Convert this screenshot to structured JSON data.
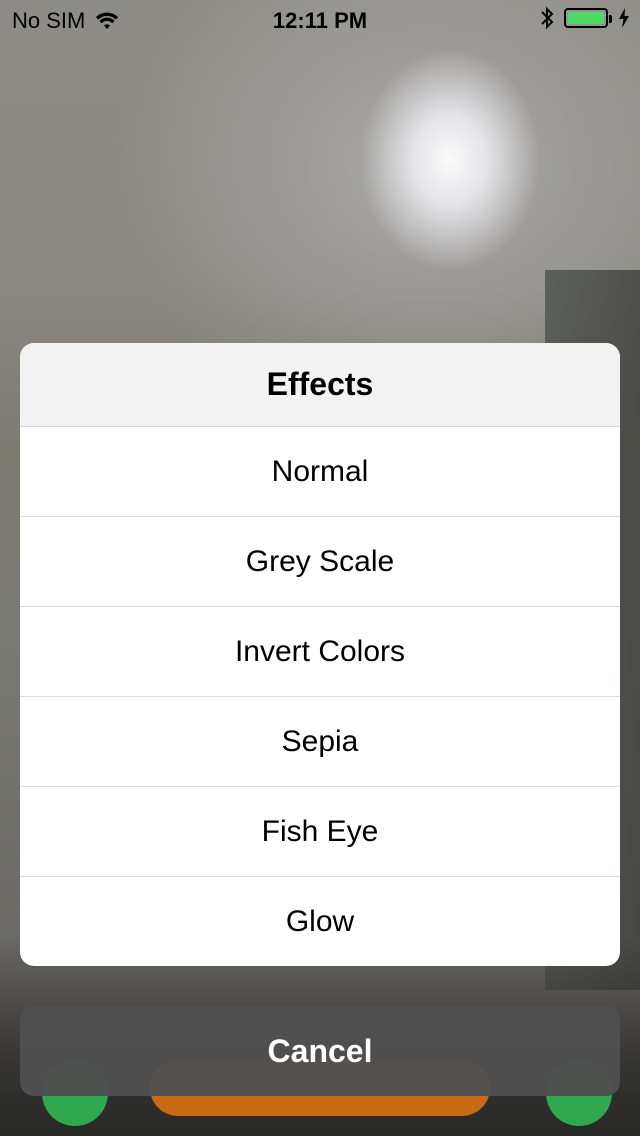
{
  "status_bar": {
    "carrier": "No SIM",
    "time": "12:11 PM",
    "battery_level": 1.0,
    "icons": [
      "wifi-icon",
      "bluetooth-icon",
      "battery-icon",
      "charging-bolt-icon"
    ]
  },
  "sheet": {
    "title": "Effects",
    "options": [
      {
        "label": "Normal"
      },
      {
        "label": "Grey Scale"
      },
      {
        "label": "Invert Colors"
      },
      {
        "label": "Sepia"
      },
      {
        "label": "Fish Eye"
      },
      {
        "label": "Glow"
      }
    ],
    "cancel_label": "Cancel"
  },
  "colors": {
    "battery_fill": "#4cd964",
    "toolbar_green": "#2fa84f",
    "toolbar_orange": "#c86a12",
    "cancel_bg": "#505050"
  }
}
